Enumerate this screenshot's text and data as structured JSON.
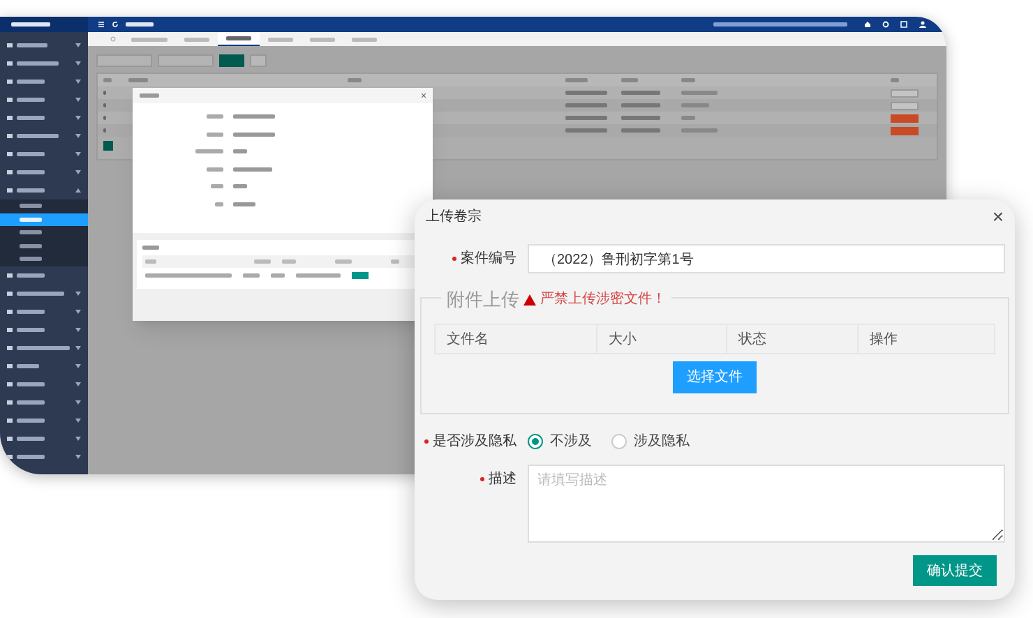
{
  "sidebar": {
    "items": [
      {
        "kind": "group",
        "expanded": false
      },
      {
        "kind": "group",
        "expanded": false
      },
      {
        "kind": "group",
        "expanded": false
      },
      {
        "kind": "group",
        "expanded": false
      },
      {
        "kind": "group",
        "expanded": false
      },
      {
        "kind": "group",
        "expanded": false
      },
      {
        "kind": "group",
        "expanded": false
      },
      {
        "kind": "group",
        "expanded": false
      },
      {
        "kind": "group",
        "expanded": true,
        "children": [
          {
            "selected": false
          },
          {
            "selected": true
          },
          {
            "selected": false
          },
          {
            "selected": false
          },
          {
            "selected": false
          }
        ]
      },
      {
        "kind": "link"
      },
      {
        "kind": "group",
        "expanded": false
      },
      {
        "kind": "group",
        "expanded": false
      },
      {
        "kind": "group",
        "expanded": false
      },
      {
        "kind": "group",
        "expanded": false
      },
      {
        "kind": "group",
        "expanded": false
      },
      {
        "kind": "group",
        "expanded": false
      },
      {
        "kind": "group",
        "expanded": false
      },
      {
        "kind": "group",
        "expanded": false
      },
      {
        "kind": "group",
        "expanded": false
      },
      {
        "kind": "group",
        "expanded": false
      }
    ]
  },
  "tabs": [
    {
      "selected": false
    },
    {
      "selected": false
    },
    {
      "selected": true
    },
    {
      "selected": false
    },
    {
      "selected": false
    },
    {
      "selected": false
    }
  ],
  "table": {
    "rows": [
      {
        "action": {
          "kind": "view"
        }
      },
      {
        "action": {
          "kind": "view"
        }
      },
      {
        "action": {
          "kind": "upload"
        }
      },
      {
        "action": {
          "kind": "upload"
        }
      }
    ]
  },
  "pagination": {
    "pages": [
      {
        "selected": true
      }
    ]
  },
  "upload_dialog": {
    "title": "上传卷宗",
    "close": "×",
    "case_number": {
      "label": "案件编号",
      "required": true,
      "value": "（2022）鲁刑初字第1号"
    },
    "attachments": {
      "legend": "附件上传",
      "warning": "严禁上传涉密文件！",
      "columns": [
        "文件名",
        "大小",
        "状态",
        "操作"
      ],
      "choose_button": "选择文件"
    },
    "privacy": {
      "label": "是否涉及隐私",
      "required": true,
      "options": [
        {
          "label": "不涉及",
          "selected": true
        },
        {
          "label": "涉及隐私",
          "selected": false
        }
      ]
    },
    "description": {
      "label": "描述",
      "required": true,
      "placeholder": "请填写描述"
    },
    "submit_button": "确认提交"
  }
}
